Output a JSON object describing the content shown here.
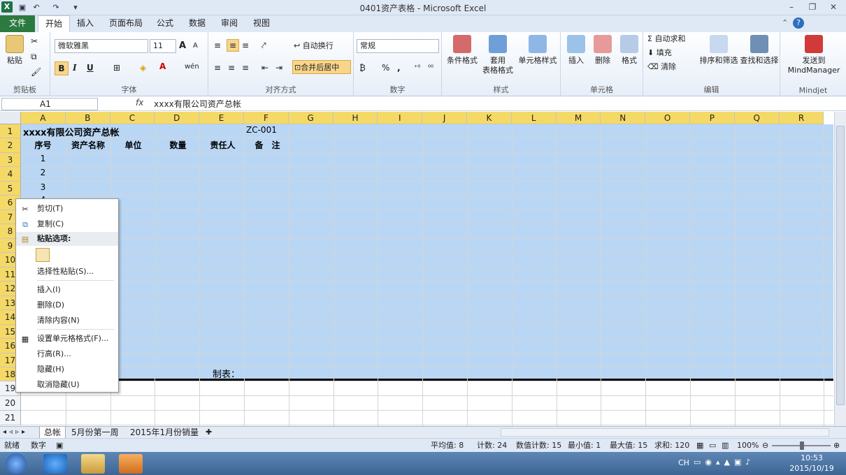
{
  "app": {
    "title": "0401资产表格 - Microsoft Excel",
    "logo": "X"
  },
  "quick_access": [
    "save-icon",
    "undo-icon",
    "redo-icon",
    "customize-icon"
  ],
  "window_controls": {
    "min": "–",
    "restore": "❐",
    "close": "✕"
  },
  "tabs": [
    "文件",
    "开始",
    "插入",
    "页面布局",
    "公式",
    "数据",
    "审阅",
    "视图"
  ],
  "ribbon": {
    "clipboard": {
      "label": "剪贴板",
      "paste": "粘贴"
    },
    "font": {
      "label": "字体",
      "name": "微软雅黑",
      "size": "11",
      "bold": "B",
      "italic": "I",
      "underline": "U",
      "grow": "A",
      "shrink": "A",
      "font_color": "A",
      "phonetic": "wén"
    },
    "alignment": {
      "label": "对齐方式",
      "wrap": "自动换行",
      "merge": "合并后居中"
    },
    "number": {
      "label": "数字",
      "format": "常规",
      "percent": "%",
      "comma": ","
    },
    "styles": {
      "label": "样式",
      "cond": "条件格式",
      "table1": "套用",
      "table2": "表格格式",
      "cell": "单元格样式"
    },
    "cells": {
      "label": "单元格",
      "insert": "插入",
      "delete": "删除",
      "format": "格式"
    },
    "editing": {
      "label": "编辑",
      "autosum": "自动求和",
      "fill": "填充",
      "clear": "清除",
      "sort": "排序和筛选",
      "find": "查找和选择"
    },
    "mindjet": {
      "label": "Mindjet",
      "send1": "发送到",
      "send2": "MindManager"
    }
  },
  "formula_bar": {
    "name_box": "A1",
    "fx": "fx",
    "formula": "xxxx有限公司资产总帐"
  },
  "columns": [
    "A",
    "B",
    "C",
    "D",
    "E",
    "F",
    "G",
    "H",
    "I",
    "J",
    "K",
    "L",
    "M",
    "N",
    "O",
    "P",
    "Q",
    "R"
  ],
  "rows": [
    "1",
    "2",
    "3",
    "4",
    "5",
    "6",
    "7",
    "8",
    "9",
    "10",
    "11",
    "12",
    "13",
    "14",
    "15",
    "16",
    "17",
    "18",
    "19",
    "20",
    "21"
  ],
  "cells": {
    "title": "xxxx有限公司资产总帐",
    "code": "ZC-001",
    "h_seq": "序号",
    "h_name": "资产名称",
    "h_unit": "单位",
    "h_qty": "数量",
    "h_owner": "责任人",
    "h_note": "备　注",
    "n1": "1",
    "n2": "2",
    "n3": "3",
    "n4": "4",
    "maker": "制表："
  },
  "context_menu": {
    "cut": "剪切(T)",
    "copy": "复制(C)",
    "paste_options": "粘贴选项:",
    "paste_special": "选择性粘贴(S)...",
    "insert": "插入(I)",
    "delete": "删除(D)",
    "clear": "清除内容(N)",
    "format_cells": "设置单元格格式(F)...",
    "row_height": "行高(R)...",
    "hide": "隐藏(H)",
    "unhide": "取消隐藏(U)"
  },
  "sheets": [
    "总帐",
    "5月份第一周",
    "2015年1月份销量"
  ],
  "status": {
    "ready": "就绪",
    "mode": "数字",
    "average": "平均值: 8",
    "count": "计数: 24",
    "num_count": "数值计数: 15",
    "min": "最小值: 1",
    "max": "最大值: 15",
    "sum": "求和: 120",
    "zoom": "100%"
  },
  "taskbar": {
    "lang": "CH",
    "time": "10:53",
    "date": "2015/10/19"
  },
  "colors": {
    "selection": "#b9d7f5",
    "header_sel": "#f5d966",
    "file_tab": "#2c7a3f"
  }
}
